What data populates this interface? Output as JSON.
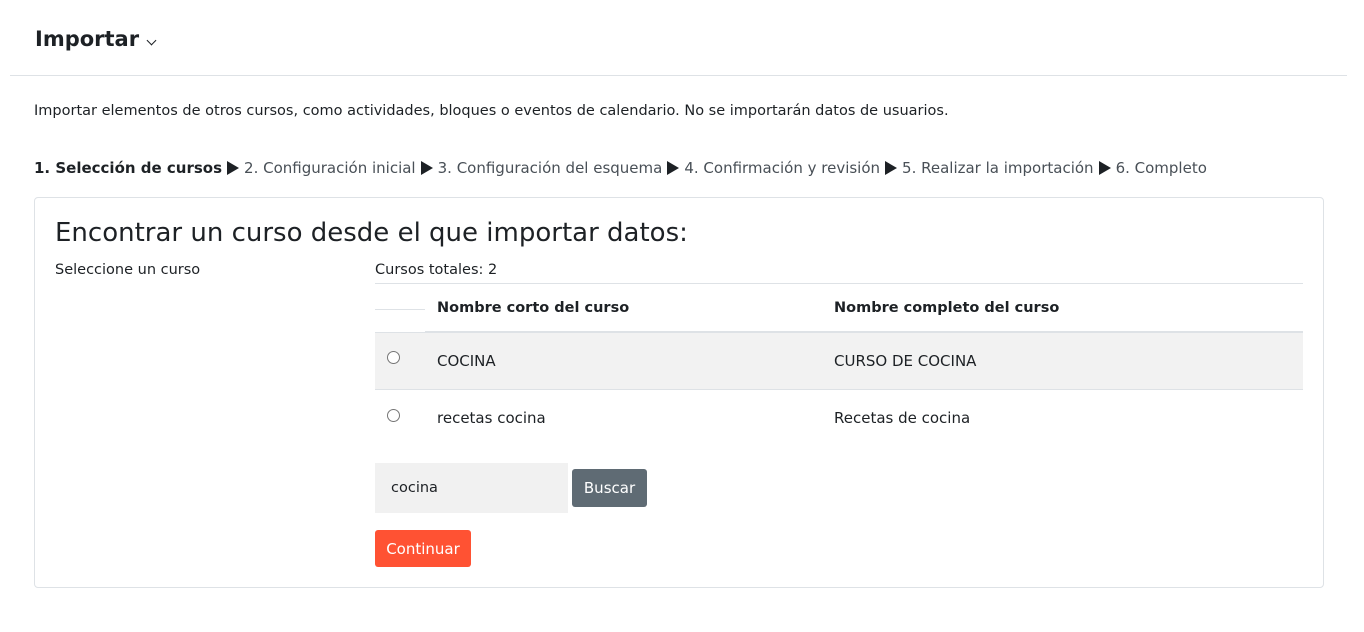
{
  "header": {
    "title": "Importar",
    "menu_icon": "chevron-down-icon"
  },
  "intro_text": "Importar elementos de otros cursos, como actividades, bloques o eventos de calendario. No se importarán datos de usuarios.",
  "steps": [
    {
      "label": "1. Selección de cursos",
      "current": true
    },
    {
      "label": "2. Configuración inicial",
      "current": false
    },
    {
      "label": "3. Configuración del esquema",
      "current": false
    },
    {
      "label": "4. Confirmación y revisión",
      "current": false
    },
    {
      "label": "5. Realizar la importación",
      "current": false
    },
    {
      "label": "6. Completo",
      "current": false
    }
  ],
  "card": {
    "title": "Encontrar un curso desde el que importar datos:",
    "select_label": "Seleccione un curso",
    "total_label": "Cursos totales: 2",
    "table": {
      "headers": [
        "",
        "Nombre corto del curso",
        "Nombre completo del curso"
      ],
      "rows": [
        {
          "short": "COCINA",
          "full": "CURSO DE COCINA",
          "selected": false
        },
        {
          "short": "recetas cocina",
          "full": "Recetas de cocina",
          "selected": false
        }
      ]
    },
    "search": {
      "value": "cocina",
      "button_label": "Buscar"
    },
    "continue_label": "Continuar"
  },
  "colors": {
    "primary_button": "#ff5233",
    "secondary_button": "#5f6b74",
    "row_stripe": "#f2f2f2",
    "border": "#dee2e6"
  }
}
